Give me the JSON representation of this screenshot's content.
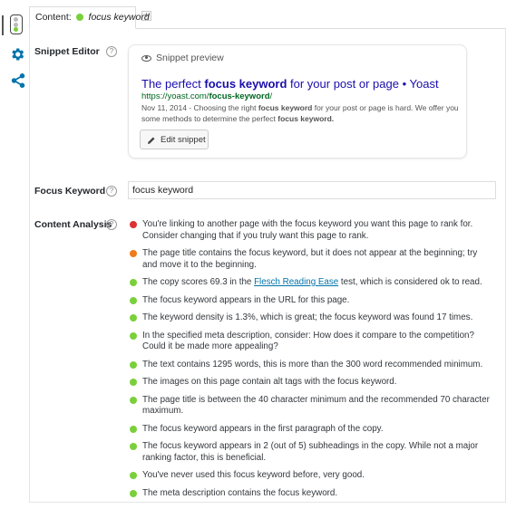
{
  "tab": {
    "label": "Content:",
    "keyword": "focus keyword",
    "add_symbol": "+"
  },
  "snippet_editor": {
    "label": "Snippet Editor",
    "help": "?",
    "preview_heading": "Snippet preview",
    "title_before": "The perfect ",
    "title_bold": "focus keyword",
    "title_after": " for your post or page • Yoast",
    "url_before": "https://yoast.com/",
    "url_bold": "focus-keyword",
    "url_after": "/",
    "desc_part1": "Nov 11, 2014 - Choosing the right ",
    "desc_bold1": "focus keyword",
    "desc_part2": " for your post or page is hard. We offer you some methods to determine the perfect ",
    "desc_bold2": "focus keyword.",
    "edit_button": "Edit snippet"
  },
  "focus_keyword": {
    "label": "Focus Keyword",
    "help": "?",
    "value": "focus keyword"
  },
  "content_analysis": {
    "label": "Content Analysis",
    "help": "?",
    "items": [
      {
        "status": "bad",
        "text": "You're linking to another page with the focus keyword you want this page to rank for. Consider changing that if you truly want this page to rank."
      },
      {
        "status": "ok",
        "text": "The page title contains the focus keyword, but it does not appear at the beginning; try and move it to the beginning."
      },
      {
        "status": "good",
        "before": "The copy scores 69.3 in the ",
        "link": "Flesch Reading Ease",
        "after": " test, which is considered ok to read."
      },
      {
        "status": "good",
        "text": "The focus keyword appears in the URL for this page."
      },
      {
        "status": "good",
        "text": "The keyword density is 1.3%, which is great; the focus keyword was found 17 times."
      },
      {
        "status": "good",
        "text": "In the specified meta description, consider: How does it compare to the competition? Could it be made more appealing?"
      },
      {
        "status": "good",
        "text": "The text contains 1295 words, this is more than the 300 word recommended minimum."
      },
      {
        "status": "good",
        "text": "The images on this page contain alt tags with the focus keyword."
      },
      {
        "status": "good",
        "text": "The page title is between the 40 character minimum and the recommended 70 character maximum."
      },
      {
        "status": "good",
        "text": "The focus keyword appears in the first paragraph of the copy."
      },
      {
        "status": "good",
        "text": "The focus keyword appears in 2 (out of 5) subheadings in the copy. While not a major ranking factor, this is beneficial."
      },
      {
        "status": "good",
        "text": "You've never used this focus keyword before, very good."
      },
      {
        "status": "good",
        "text": "The meta description contains the focus keyword."
      }
    ]
  },
  "sidebar": {
    "icons": [
      "traffic-light-icon",
      "gear-icon",
      "share-icon"
    ]
  },
  "colors": {
    "bad": "#dc3232",
    "ok": "#ee7c1b",
    "good": "#7ad03a",
    "link": "#0073aa",
    "snippet_title": "#1a0dab",
    "snippet_url": "#006621"
  }
}
